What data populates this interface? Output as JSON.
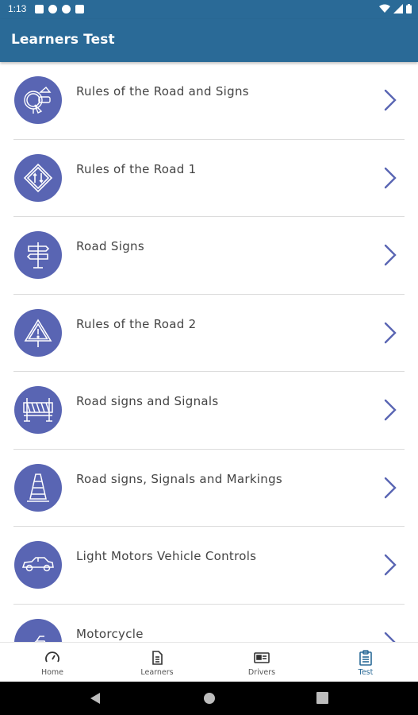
{
  "status_bar": {
    "time": "1:13",
    "left_icons": [
      "notification-icon",
      "notification-icon",
      "notification-icon",
      "sim-icon"
    ],
    "right_icons": [
      "wifi-icon",
      "signal-icon",
      "battery-icon"
    ]
  },
  "app_bar": {
    "title": "Learners Test",
    "color": "#2a6a97"
  },
  "list": {
    "items": [
      {
        "label": "Rules of the Road and Signs",
        "icon": "traffic-signs-icon"
      },
      {
        "label": "Rules of the Road 1",
        "icon": "diamond-road-sign-icon"
      },
      {
        "label": "Road Signs",
        "icon": "signpost-icon"
      },
      {
        "label": "Rules of the Road 2",
        "icon": "warning-triangle-icon"
      },
      {
        "label": "Road signs and Signals",
        "icon": "road-barrier-icon"
      },
      {
        "label": "Road signs, Signals and Markings",
        "icon": "traffic-cone-icon"
      },
      {
        "label": "Light Motors Vehicle Controls",
        "icon": "car-icon"
      },
      {
        "label": "Motorcycle",
        "icon": "motorcycle-icon"
      }
    ],
    "icon_color": "#5965b3",
    "chevron_color": "#5965b3"
  },
  "bottom_nav": {
    "items": [
      {
        "label": "Home",
        "icon": "speedometer-icon",
        "active": false
      },
      {
        "label": "Learners",
        "icon": "document-icon",
        "active": false
      },
      {
        "label": "Drivers",
        "icon": "id-card-icon",
        "active": false
      },
      {
        "label": "Test",
        "icon": "clipboard-icon",
        "active": true
      }
    ],
    "active_color": "#2a6a97"
  },
  "system_nav": {
    "buttons": [
      "back-icon",
      "home-icon",
      "recents-icon"
    ]
  }
}
